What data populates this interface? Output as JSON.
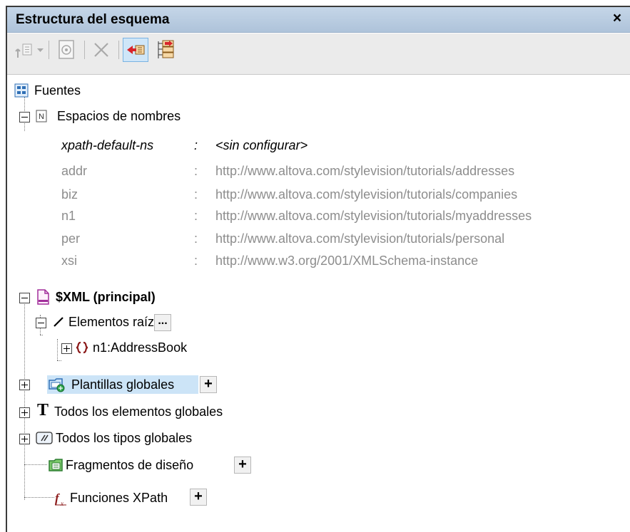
{
  "window": {
    "title": "Estructura del esquema",
    "close_glyph": "×"
  },
  "toolbar": {
    "buttons": [
      {
        "name": "add-element-icon",
        "enabled": false
      },
      {
        "name": "dropdown-arrow-icon",
        "enabled": false
      },
      {
        "name": "settings-icon",
        "enabled": false
      },
      {
        "name": "delete-icon",
        "enabled": false
      },
      {
        "name": "collapse-red-arrow-icon",
        "enabled": true,
        "active": true
      },
      {
        "name": "schema-list-icon",
        "enabled": true
      }
    ]
  },
  "tree": {
    "root": {
      "label": "Fuentes",
      "icon": "sources-icon"
    },
    "namespaces": {
      "label": "Espacios de nombres",
      "icon": "namespace-n-icon",
      "separator": ":",
      "default": {
        "prefix": "xpath-default-ns",
        "value": "<sin configurar>"
      },
      "items": [
        {
          "prefix": "addr",
          "uri": "http://www.altova.com/stylevision/tutorials/addresses"
        },
        {
          "prefix": "biz",
          "uri": "http://www.altova.com/stylevision/tutorials/companies"
        },
        {
          "prefix": "n1",
          "uri": "http://www.altova.com/stylevision/tutorials/myaddresses"
        },
        {
          "prefix": "per",
          "uri": "http://www.altova.com/stylevision/tutorials/personal"
        },
        {
          "prefix": "xsi",
          "uri": "http://www.w3.org/2001/XMLSchema-instance"
        }
      ]
    },
    "xml_source": {
      "label": "$XML (principal)",
      "icon": "xml-file-icon"
    },
    "root_elements": {
      "label": "Elementos raíz",
      "icon": "slash-icon",
      "more_label": "..."
    },
    "address_book": {
      "label": "n1:AddressBook",
      "icon": "element-braces-icon"
    },
    "global_templates": {
      "label": "Plantillas globales",
      "add_label": "+",
      "icon": "global-templates-icon"
    },
    "all_global_elements": {
      "label": "Todos los elementos globales",
      "icon": "t-type-icon"
    },
    "all_global_types": {
      "label": "Todos los tipos globales",
      "icon": "global-types-icon"
    },
    "design_fragments": {
      "label": "Fragmentos de diseño",
      "add_label": "+",
      "icon": "design-fragments-icon"
    },
    "xpath_functions": {
      "label": "Funciones XPath",
      "add_label": "+",
      "icon": "xpath-function-icon"
    }
  }
}
